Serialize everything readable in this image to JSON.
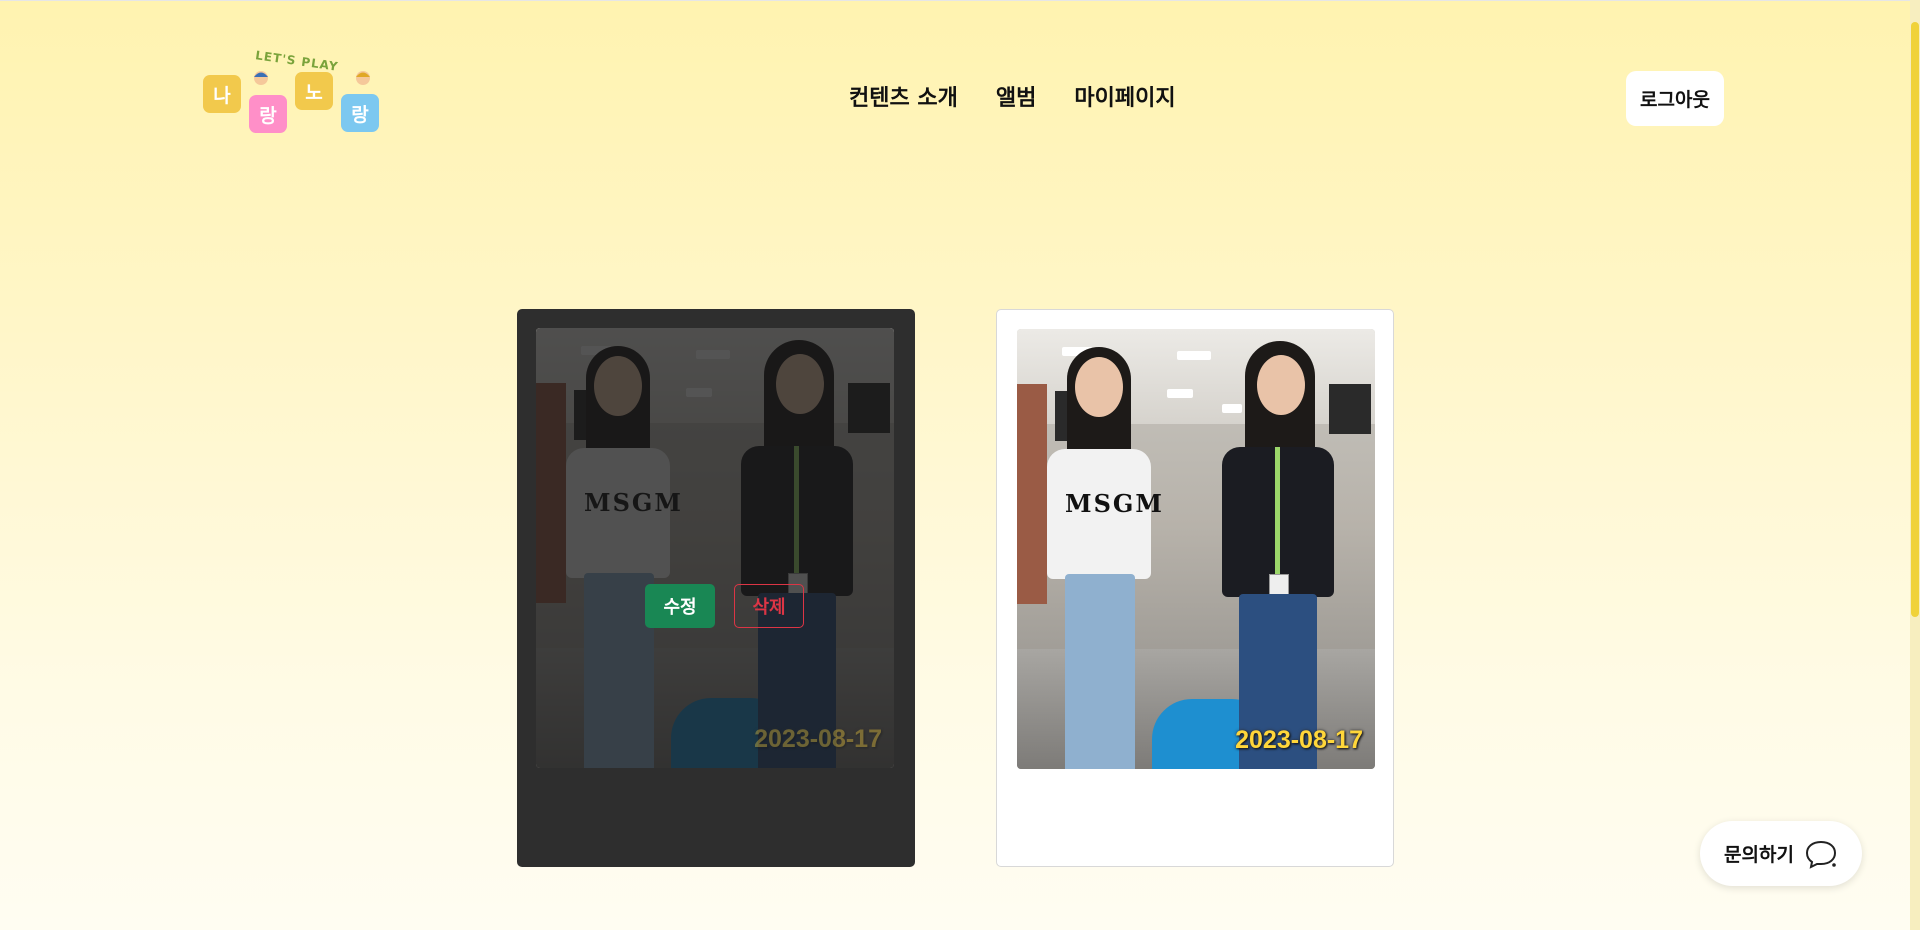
{
  "logo": {
    "arc_text": "LET'S PLAY",
    "tiles": [
      "나",
      "랑",
      "노",
      "랑"
    ],
    "tile_colors": [
      "#f2c94c",
      "#ff8fc8",
      "#f2c94c",
      "#7cc8f0"
    ]
  },
  "nav": {
    "items": [
      "컨텐츠 소개",
      "앨범",
      "마이페이지"
    ]
  },
  "header": {
    "logout_label": "로그아웃"
  },
  "album": {
    "cards": [
      {
        "date": "2023-08-17",
        "state": "hover-overlay",
        "edit_label": "수정",
        "delete_label": "삭제"
      },
      {
        "date": "2023-08-17",
        "state": "normal"
      }
    ]
  },
  "inquiry": {
    "label": "문의하기",
    "icon": "chat-bubble-icon"
  },
  "colors": {
    "accent_yellow": "#ffd63a",
    "edit_green": "#198754",
    "delete_red": "#dc3545",
    "card_dark": "#2e2e2e"
  }
}
